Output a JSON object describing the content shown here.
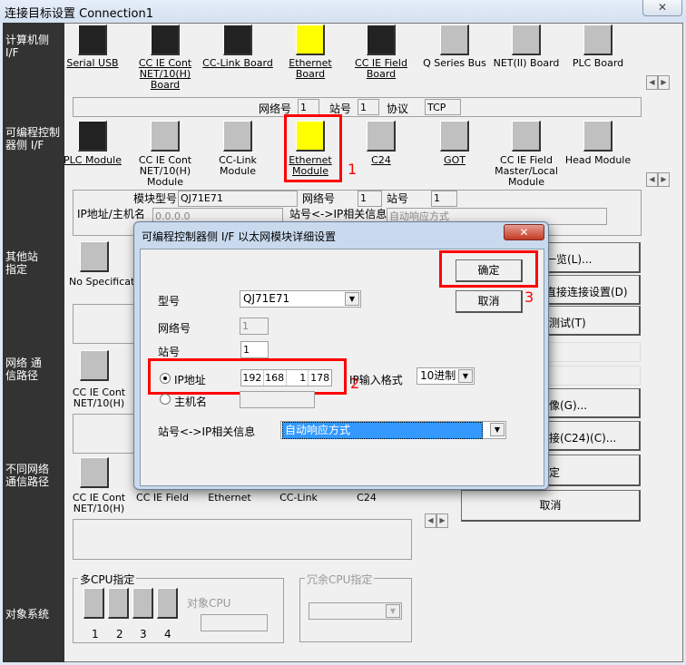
{
  "window": {
    "title": "连接目标设置 Connection1",
    "close": "✕"
  },
  "side_labels": [
    "计算机侧 I/F",
    "可编程控制器侧 I/F",
    "其他站指定",
    "网络 通信路径",
    "不同网络 通信路径",
    "对象系统"
  ],
  "pc_if": [
    {
      "label": "Serial USB",
      "linked": true
    },
    {
      "label": "CC IE Cont NET/10(H) Board",
      "linked": true
    },
    {
      "label": "CC-Link Board",
      "linked": true
    },
    {
      "label": "Ethernet Board",
      "linked": true
    },
    {
      "label": "CC IE Field Board",
      "linked": true
    },
    {
      "label": "Q Series Bus",
      "linked": false
    },
    {
      "label": "NET(II) Board",
      "linked": false
    },
    {
      "label": "PLC Board",
      "linked": false
    }
  ],
  "pc_info": {
    "net_label": "网络号",
    "net": "1",
    "station_label": "站号",
    "station": "1",
    "protocol_label": "协议",
    "protocol": "TCP"
  },
  "plc_if": [
    {
      "label": "PLC Module"
    },
    {
      "label": "CC IE Cont NET/10(H) Module"
    },
    {
      "label": "CC-Link Module"
    },
    {
      "label": "Ethernet Module"
    },
    {
      "label": "C24"
    },
    {
      "label": "GOT"
    },
    {
      "label": "CC IE Field Master/Local Module"
    },
    {
      "label": "Head Module"
    }
  ],
  "plc_info": {
    "model_label": "模块型号",
    "model": "QJ71E71",
    "net_label": "网络号",
    "net": "1",
    "station_label": "站号",
    "station": "1",
    "ip_label": "IP地址/主机名",
    "ip": "0.0.0.0",
    "rel_label": "站号<->IP相关信息",
    "rel": "自动响应方式"
  },
  "other_station": {
    "label": "No Specification"
  },
  "network_route": {
    "label": "CC IE Cont NET/10(H)"
  },
  "diff_network": {
    "labels": [
      "CC IE Cont NET/10(H)",
      "CC IE Field",
      "Ethernet",
      "CC-Link",
      "C24"
    ]
  },
  "right_buttons": [
    "一览(L)...",
    "直接连接设置(D)",
    "测试(T)",
    "像(G)...",
    "接(C24)(C)...",
    "定",
    "取消"
  ],
  "multi_cpu": {
    "title": "多CPU指定",
    "target_label": "对象CPU",
    "nums": [
      "1",
      "2",
      "3",
      "4"
    ]
  },
  "redundant_cpu": {
    "title": "冗余CPU指定"
  },
  "annotations": [
    "1",
    "2",
    "3"
  ],
  "dialog": {
    "title": "可编程控制器侧 I/F 以太网模块详细设置",
    "close": "✕",
    "ok": "确定",
    "cancel": "取消",
    "model_label": "型号",
    "model": "QJ71E71",
    "net_label": "网络号",
    "net": "1",
    "station_label": "站号",
    "station": "1",
    "ip_radio": "IP地址",
    "ip": [
      "192",
      "168",
      "1",
      "178"
    ],
    "ip_format_label": "IP输入格式",
    "ip_format": "10进制",
    "host_radio": "主机名",
    "host": "",
    "rel_label": "站号<->IP相关信息",
    "rel": "自动响应方式"
  }
}
